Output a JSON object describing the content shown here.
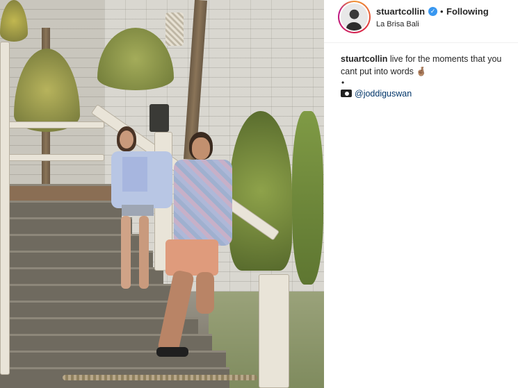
{
  "post": {
    "image_alt": "",
    "header": {
      "username": "stuartcollin",
      "verified_icon": "verified-badge-icon",
      "separator": "•",
      "follow_status": "Following",
      "location": "La Brisa Bali"
    },
    "caption": {
      "username": "stuartcollin",
      "text": "live for the moments that you cant put into words",
      "emoji": "🤞🏽",
      "bullet": "•",
      "camera_icon": "camera-icon",
      "credit": "@joddiguswan"
    },
    "colors": {
      "verified": "#3897f0",
      "mention": "#003569",
      "ring_start": "#f09433",
      "ring_end": "#bc1888"
    }
  }
}
